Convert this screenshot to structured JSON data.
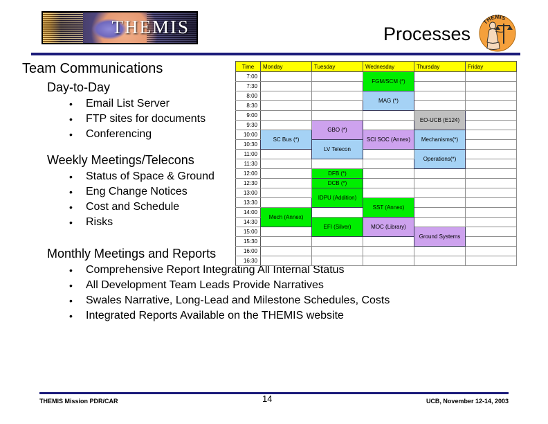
{
  "header": {
    "logo_text": "THEMIS",
    "title": "Processes",
    "patch_text": "THEMIS",
    "rule_color": "#1b1b7a"
  },
  "content": {
    "section1_heading": "Team Communications",
    "sub1_heading": "Day-to-Day",
    "sub1_items": [
      "Email List Server",
      "FTP sites for documents",
      "Conferencing"
    ],
    "sub2_heading": "Weekly Meetings/Telecons",
    "sub2_items": [
      "Status of Space & Ground",
      "Eng Change Notices",
      "Cost and Schedule",
      "Risks"
    ],
    "sub3_heading": "Monthly Meetings and Reports",
    "sub3_items": [
      "Comprehensive Report Integrating All Internal Status",
      "All Development Team Leads Provide Narratives",
      "Swales Narrative, Long-Lead and Milestone Schedules, Costs",
      "Integrated Reports Available on the THEMIS website"
    ],
    "bullet_glyph": "•"
  },
  "schedule": {
    "columns": [
      "Time",
      "Monday",
      "Tuesday",
      "Wednesday",
      "Thursday",
      "Friday"
    ],
    "times": [
      "7:00",
      "7:30",
      "8:00",
      "8:30",
      "9:00",
      "9:30",
      "10:00",
      "10:30",
      "11:00",
      "11:30",
      "12:00",
      "12:30",
      "13:00",
      "13:30",
      "14:00",
      "14:30",
      "15:00",
      "15:30",
      "16:00",
      "16:30"
    ],
    "events": [
      {
        "label": "FGM/SCM (*)",
        "day": "Wednesday",
        "start": "7:00",
        "rows": 2,
        "color": "#00ee00"
      },
      {
        "label": "MAG (*)",
        "day": "Wednesday",
        "start": "8:00",
        "rows": 2,
        "color": "#a5d2f5"
      },
      {
        "label": "EO-UCB (E124)",
        "day": "Thursday",
        "start": "9:00",
        "rows": 2,
        "color": "#c0c0c0"
      },
      {
        "label": "GBO (*)",
        "day": "Tuesday",
        "start": "9:30",
        "rows": 2,
        "color": "#cda2ee"
      },
      {
        "label": "SC Bus (*)",
        "day": "Monday",
        "start": "10:00",
        "rows": 2,
        "color": "#a5d2f5"
      },
      {
        "label": "SCI SOC (Annex)",
        "day": "Wednesday",
        "start": "10:00",
        "rows": 2,
        "color": "#cda2ee"
      },
      {
        "label": "Mechanisms(*)",
        "day": "Thursday",
        "start": "10:00",
        "rows": 2,
        "color": "#a5d2f5"
      },
      {
        "label": "LV Telecon",
        "day": "Tuesday",
        "start": "10:30",
        "rows": 2,
        "color": "#a5d2f5"
      },
      {
        "label": "Operations(*)",
        "day": "Thursday",
        "start": "11:00",
        "rows": 2,
        "color": "#a5d2f5"
      },
      {
        "label": "DFB (*)",
        "day": "Tuesday",
        "start": "12:00",
        "rows": 1,
        "color": "#00ee00"
      },
      {
        "label": "DCB (*)",
        "day": "Tuesday",
        "start": "12:30",
        "rows": 1,
        "color": "#00ee00"
      },
      {
        "label": "IDPU (Addition)",
        "day": "Tuesday",
        "start": "13:00",
        "rows": 2,
        "color": "#00ee00"
      },
      {
        "label": "SST (Annex)",
        "day": "Wednesday",
        "start": "13:30",
        "rows": 2,
        "color": "#00ee00"
      },
      {
        "label": "Mech (Annex)",
        "day": "Monday",
        "start": "14:00",
        "rows": 2,
        "color": "#00ee00"
      },
      {
        "label": "EFI (Silver)",
        "day": "Tuesday",
        "start": "14:30",
        "rows": 2,
        "color": "#00ee00"
      },
      {
        "label": "MOC (Library)",
        "day": "Wednesday",
        "start": "14:30",
        "rows": 2,
        "color": "#cda2ee"
      },
      {
        "label": "Ground Systems",
        "day": "Thursday",
        "start": "15:00",
        "rows": 2,
        "color": "#cda2ee"
      }
    ],
    "header_bg": "#ffff00"
  },
  "footer": {
    "left": "THEMIS Mission PDR/CAR",
    "page": "14",
    "right": "UCB, November 12-14, 2003"
  }
}
